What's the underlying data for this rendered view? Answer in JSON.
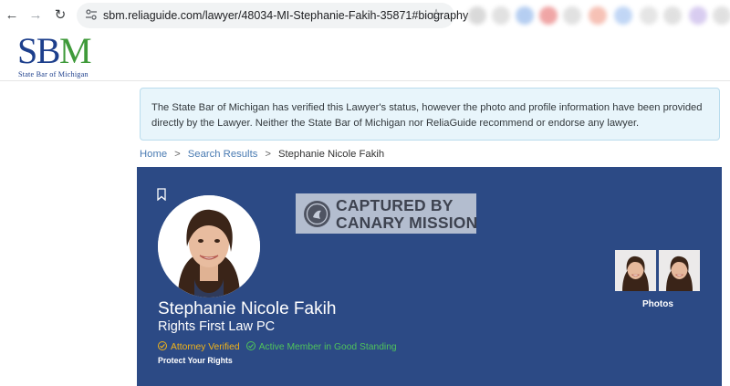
{
  "browser": {
    "url": "sbm.reliaguide.com/lawyer/48034-MI-Stephanie-Fakih-35871#biography",
    "back_icon": "arrow-left-icon",
    "forward_icon": "arrow-right-icon",
    "reload_icon": "reload-icon",
    "bookmark_icon": "star-icon"
  },
  "header": {
    "logo_s": "S",
    "logo_b": "B",
    "logo_m": "M",
    "logo_sub": "State Bar of Michigan",
    "colors": {
      "logo_blue": "#1d3f8c",
      "logo_green": "#3f9a3a"
    }
  },
  "notice": {
    "text": "The State Bar of Michigan has verified this Lawyer's status, however the photo and profile information have been provided directly by the Lawyer. Neither the State Bar of Michigan nor ReliaGuide recommend or endorse any lawyer."
  },
  "breadcrumb": {
    "home": "Home",
    "sep": ">",
    "search_results": "Search Results",
    "current": "Stephanie Nicole Fakih"
  },
  "profile": {
    "name": "Stephanie Nicole Fakih",
    "firm": "Rights First Law PC",
    "verified_label": "Attorney Verified",
    "standing_label": "Active Member in Good Standing",
    "tagline": "Protect Your Rights",
    "photos_label": "Photos",
    "watermark_text": "CAPTURED BY\nCANARY MISSION",
    "colors": {
      "card_bg": "#2c4a85",
      "verified": "#f2b418",
      "standing": "#4fc35b"
    }
  }
}
